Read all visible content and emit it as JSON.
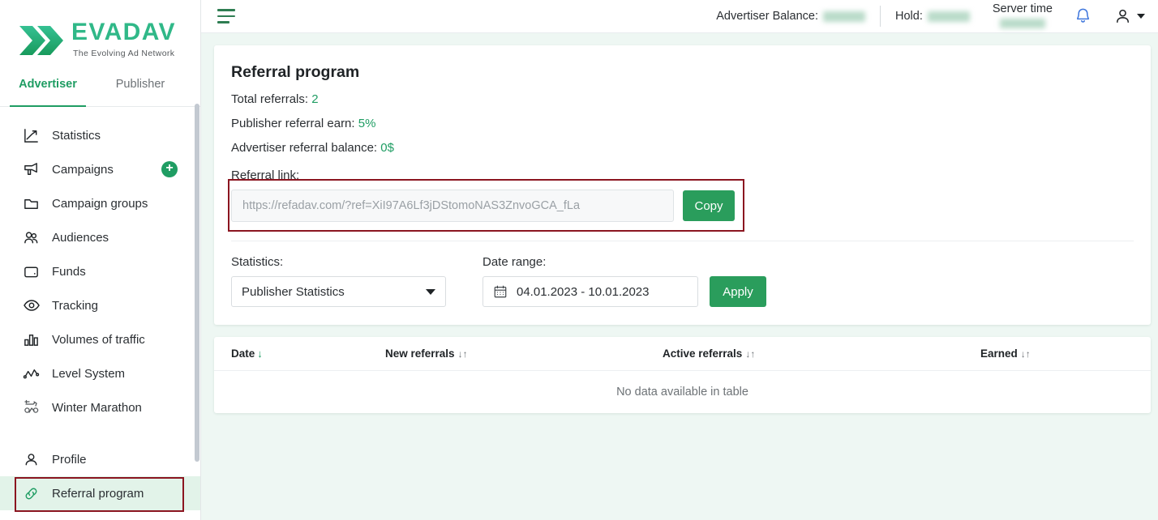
{
  "brand": {
    "name": "EVADAV",
    "tagline": "The Evolving Ad Network",
    "green": "#30b888",
    "green_dark": "#1f9d63"
  },
  "sidebar": {
    "tabs": [
      {
        "label": "Advertiser",
        "active": true
      },
      {
        "label": "Publisher",
        "active": false
      }
    ],
    "items": [
      {
        "label": "Statistics",
        "icon": "statistics-icon"
      },
      {
        "label": "Campaigns",
        "icon": "megaphone-icon",
        "badge": "+"
      },
      {
        "label": "Campaign groups",
        "icon": "folder-icon"
      },
      {
        "label": "Audiences",
        "icon": "audiences-icon"
      },
      {
        "label": "Funds",
        "icon": "wallet-icon"
      },
      {
        "label": "Tracking",
        "icon": "eye-icon"
      },
      {
        "label": "Volumes of traffic",
        "icon": "bar-chart-icon"
      },
      {
        "label": "Level System",
        "icon": "level-line-icon"
      },
      {
        "label": "Winter Marathon",
        "icon": "winter-marathon-icon"
      }
    ],
    "bottom_items": [
      {
        "label": "Profile",
        "icon": "person-icon",
        "active": false
      },
      {
        "label": "Referral program",
        "icon": "link-chain-icon",
        "active": true
      }
    ]
  },
  "topbar": {
    "menu_icon": "hamburger-icon",
    "advertiser_balance_label": "Advertiser Balance:",
    "advertiser_balance_value": "",
    "hold_label": "Hold:",
    "hold_value": "",
    "server_time_label": "Server time",
    "server_time_value": "",
    "bell_icon": "notification-bell-icon",
    "user_icon": "user-avatar-icon",
    "caret_icon": "chevron-down-icon"
  },
  "page": {
    "title": "Referral program",
    "stats": [
      {
        "label": "Total referrals:",
        "value": "2"
      },
      {
        "label": "Publisher referral earn:",
        "value": "5%"
      },
      {
        "label": "Advertiser referral balance:",
        "value": "0$"
      }
    ],
    "referral": {
      "label": "Referral link:",
      "placeholder": "https://refadav.com/?ref=XiI97A6Lf3jDStomoNAS3ZnvoGCA_fLa",
      "value": "",
      "copy_label": "Copy"
    },
    "filters": {
      "statistics_label": "Statistics:",
      "statistics_value": "Publisher Statistics",
      "date_label": "Date range:",
      "date_value": "04.01.2023 - 10.01.2023",
      "calendar_icon": "calendar-icon",
      "apply_label": "Apply"
    },
    "table": {
      "columns": [
        {
          "label": "Date",
          "sort": "↓",
          "sorted": true
        },
        {
          "label": "New referrals",
          "sort": "↓↑",
          "sorted": false
        },
        {
          "label": "Active referrals",
          "sort": "↓↑",
          "sorted": false
        },
        {
          "label": "Earned",
          "sort": "↓↑",
          "sorted": false
        }
      ],
      "rows": [],
      "empty_text": "No data available in table"
    }
  },
  "annotations": {
    "referral_box_color": "#8b1520",
    "sidebar_box_color": "#8b1520"
  }
}
